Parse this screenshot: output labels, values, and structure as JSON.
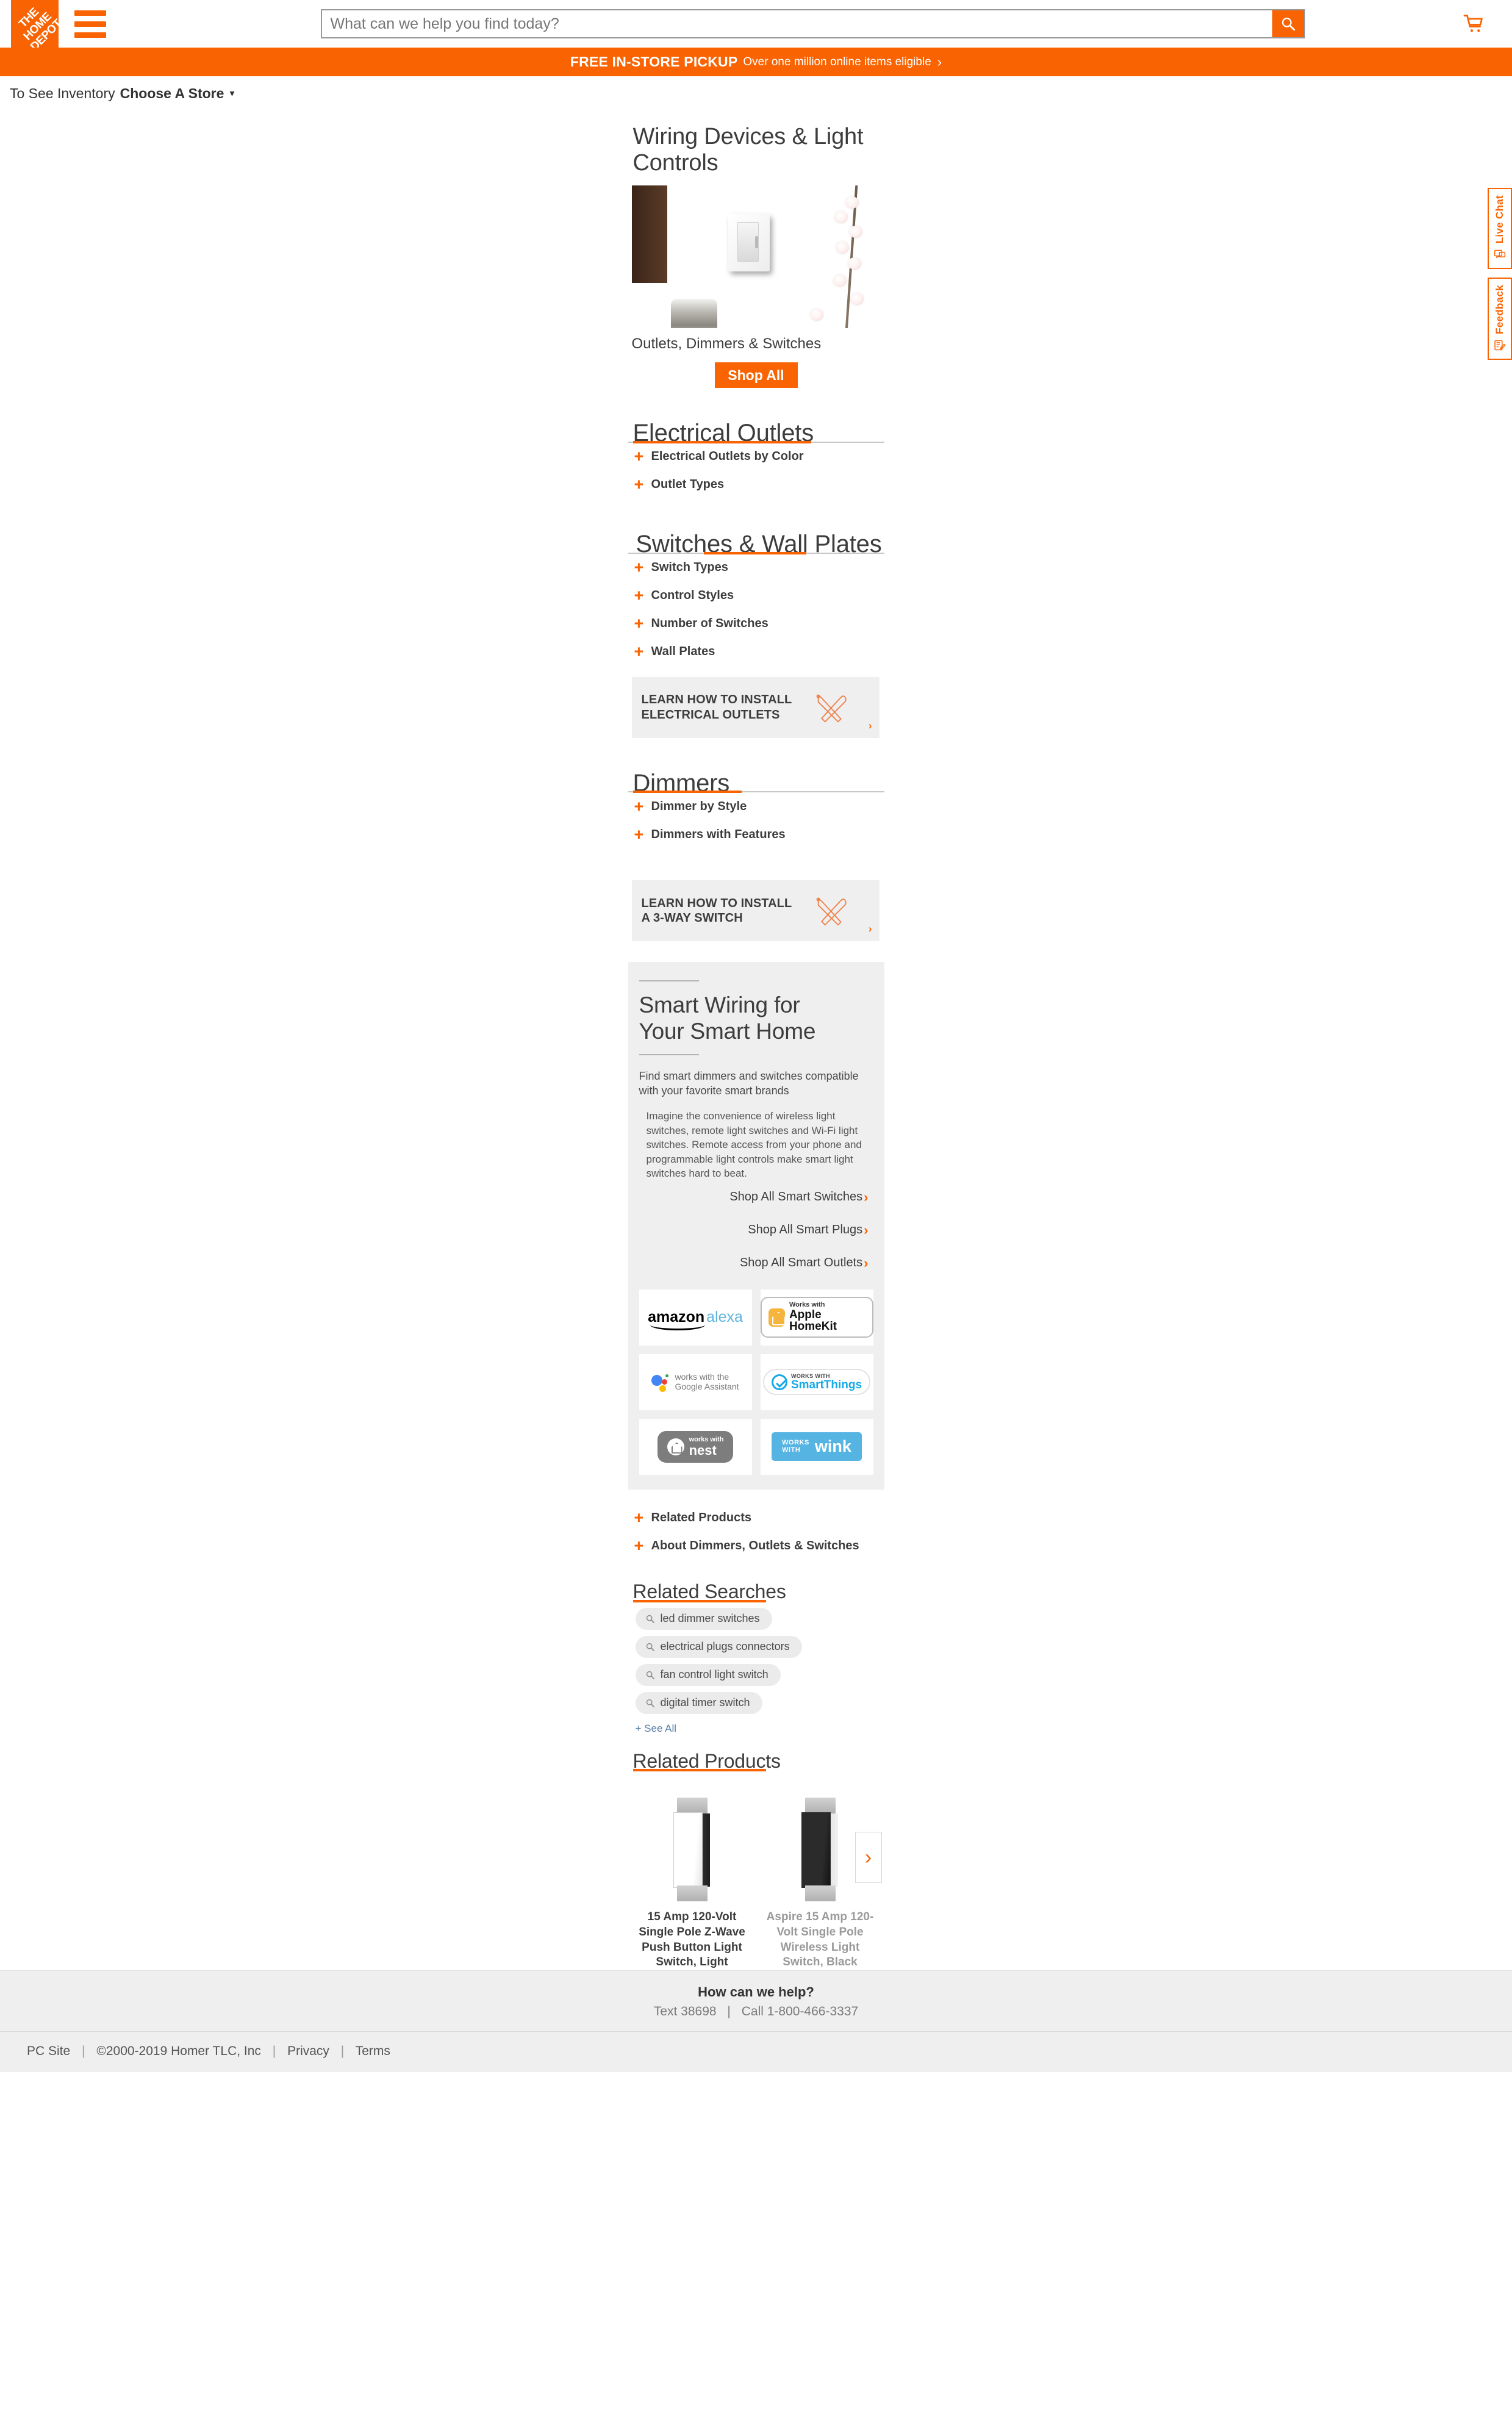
{
  "header": {
    "logo_text": "THE HOME DEPOT",
    "logo_alt": "home-depot-logo",
    "menu_label": "Menu",
    "search_placeholder": "What can we help you find today?",
    "search_value": "",
    "search_icon": "search-icon",
    "cart_icon": "shopping-cart-icon",
    "accent_color": "#f96302"
  },
  "promo": {
    "bold": "FREE IN-STORE PICKUP",
    "normal": "Over one million online items eligible",
    "chevron": "›"
  },
  "store_bar": {
    "prefix": "To See Inventory",
    "action": "Choose A Store",
    "caret": "▾"
  },
  "hero": {
    "title": "Wiring Devices & Light Controls",
    "image_alt": "dimmer-switch-on-wall-photo",
    "caption": "Outlets, Dimmers & Switches",
    "button": "Shop All"
  },
  "sections": [
    {
      "id": "electrical-outlets",
      "heading": "Electrical Outlets",
      "align": "left",
      "items": [
        "Electrical Outlets by Color",
        "Outlet Types"
      ]
    },
    {
      "id": "switches-wall-plates",
      "heading": "Switches & Wall Plates",
      "align": "right",
      "items": [
        "Switch Types",
        "Control Styles",
        "Number of Switches",
        "Wall Plates"
      ]
    },
    {
      "id": "dimmers",
      "heading": "Dimmers",
      "align": "left",
      "items": [
        "Dimmer by Style",
        "Dimmers with Features"
      ]
    }
  ],
  "learn_banners": [
    {
      "line1": "LEARN HOW TO INSTALL",
      "line2": "ELECTRICAL OUTLETS",
      "icon": "hammer-screwdriver-icon",
      "chevron": "›"
    },
    {
      "line1": "LEARN HOW TO INSTALL",
      "line2": "A 3-WAY SWITCH",
      "icon": "hammer-screwdriver-icon",
      "chevron": "›"
    }
  ],
  "smart": {
    "title_line1": "Smart Wiring for",
    "title_line2": "Your Smart Home",
    "lead": "Find smart dimmers and switches compatible with your favorite smart brands",
    "body": "Imagine the convenience of wireless light switches, remote light switches and Wi-Fi light switches. Remote access from your phone and programmable light controls make smart light switches hard to beat.",
    "links": [
      {
        "label": "Shop All Smart Switches",
        "chevron": "›"
      },
      {
        "label": "Shop All Smart Plugs",
        "chevron": "›"
      },
      {
        "label": "Shop All Smart Outlets",
        "chevron": "›"
      }
    ],
    "brands": [
      {
        "id": "amazon-alexa",
        "word1": "amazon",
        "word2": "alexa"
      },
      {
        "id": "apple-homekit",
        "small": "Works with",
        "big": "Apple HomeKit"
      },
      {
        "id": "google-assistant",
        "line1": "works with the",
        "line2": "Google Assistant"
      },
      {
        "id": "smartthings",
        "small": "WORKS WITH",
        "big": "SmartThings"
      },
      {
        "id": "nest",
        "small": "works with",
        "big": "nest"
      },
      {
        "id": "wink",
        "small1": "WORKS",
        "small2": "WITH",
        "big": "wink"
      }
    ]
  },
  "extra_expanders": [
    "Related Products",
    "About Dimmers, Outlets & Switches"
  ],
  "related_searches": {
    "heading": "Related Searches",
    "icon": "search-icon",
    "pills": [
      "led dimmer switches",
      "electrical plugs connectors",
      "fan control light switch",
      "digital timer switch"
    ],
    "see_all": "+ See All"
  },
  "related_products": {
    "heading": "Related Products",
    "next_chevron": "›",
    "items": [
      {
        "title": "15 Amp 120-Volt Single Pole Z-Wave Push Button Light Switch, Light",
        "image_alt": "white-z-wave-light-switch"
      },
      {
        "title": "Aspire 15 Amp 120-Volt Single Pole Wireless Light Switch, Black",
        "image_alt": "black-wireless-light-switch"
      }
    ]
  },
  "footer": {
    "help_title": "How can we help?",
    "text_label": "Text 38698",
    "separator": "|",
    "call_label": "Call 1-800-466-3337",
    "links": [
      "PC Site",
      "©2000-2019 Homer TLC, Inc",
      "Privacy",
      "Terms"
    ]
  },
  "side_tabs": [
    {
      "id": "live-chat",
      "label": "Live Chat",
      "icon": "chat-bubble-icon"
    },
    {
      "id": "feedback",
      "label": "Feedback",
      "icon": "feedback-pencil-icon"
    }
  ]
}
